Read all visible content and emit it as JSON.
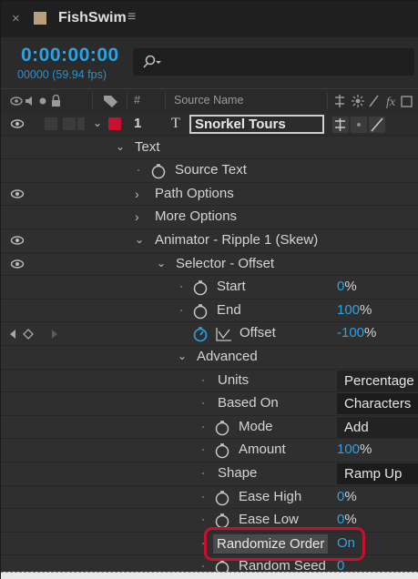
{
  "tab": {
    "close": "×",
    "title": "FishSwim",
    "menu": "≡"
  },
  "time": {
    "timecode": "0:00:00:00",
    "fps": "00000 (59.94 fps)"
  },
  "search": {
    "placeholder": ""
  },
  "columns": {
    "hash": "#",
    "source_name": "Source Name"
  },
  "layer": {
    "number": "1",
    "type_glyph": "T",
    "name": "Snorkel Tours"
  },
  "rows": [
    {
      "label": "Text"
    },
    {
      "label": "Source Text"
    },
    {
      "label": "Path Options"
    },
    {
      "label": "More Options"
    },
    {
      "label": "Animator - Ripple 1 (Skew)"
    },
    {
      "label": "Selector - Offset"
    },
    {
      "label": "Start",
      "value": "0",
      "unit": "%"
    },
    {
      "label": "End",
      "value": "100",
      "unit": "%"
    },
    {
      "label": "Offset",
      "value": "-100",
      "unit": "%"
    },
    {
      "label": "Advanced"
    },
    {
      "label": "Units",
      "value": "Percentage"
    },
    {
      "label": "Based On",
      "value": "Characters"
    },
    {
      "label": "Mode",
      "value": "Add"
    },
    {
      "label": "Amount",
      "value": "100",
      "unit": "%"
    },
    {
      "label": "Shape",
      "value": "Ramp Up"
    },
    {
      "label": "Ease High",
      "value": "0",
      "unit": "%"
    },
    {
      "label": "Ease Low",
      "value": "0",
      "unit": "%"
    },
    {
      "label": "Randomize Order",
      "value": "On"
    },
    {
      "label": "Random Seed",
      "value": "0"
    }
  ],
  "colors": {
    "accent": "#2aa3e6",
    "label_red": "#c8102e",
    "highlight": "#c8102e"
  }
}
